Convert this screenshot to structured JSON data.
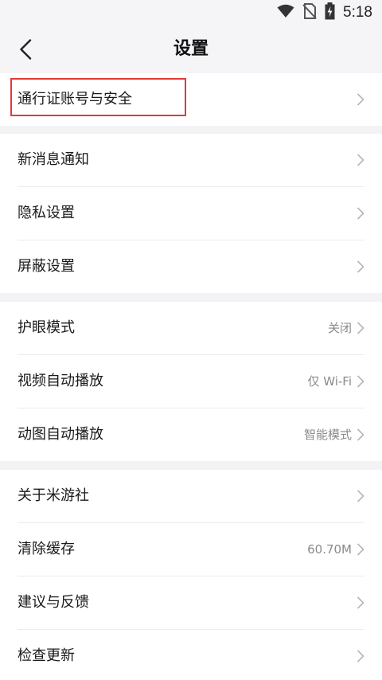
{
  "status_bar": {
    "time": "5:18",
    "icons": [
      "wifi-icon",
      "no-sim-icon",
      "battery-charging-icon"
    ]
  },
  "header": {
    "title": "设置",
    "back_icon": "chevron-left-icon"
  },
  "sections": [
    {
      "items": [
        {
          "label": "通行证账号与安全",
          "value": "",
          "highlighted": true
        }
      ]
    },
    {
      "items": [
        {
          "label": "新消息通知",
          "value": ""
        },
        {
          "label": "隐私设置",
          "value": ""
        },
        {
          "label": "屏蔽设置",
          "value": ""
        }
      ]
    },
    {
      "items": [
        {
          "label": "护眼模式",
          "value": "关闭"
        },
        {
          "label": "视频自动播放",
          "value": "仅 Wi-Fi"
        },
        {
          "label": "动图自动播放",
          "value": "智能模式"
        }
      ]
    },
    {
      "items": [
        {
          "label": "关于米游社",
          "value": ""
        },
        {
          "label": "清除缓存",
          "value": "60.70M"
        },
        {
          "label": "建议与反馈",
          "value": ""
        },
        {
          "label": "检查更新",
          "value": ""
        }
      ]
    }
  ],
  "colors": {
    "highlight_border": "#e23a3a",
    "background": "#f3f3f5",
    "row_background": "#ffffff",
    "secondary_text": "#8a8a8a"
  }
}
